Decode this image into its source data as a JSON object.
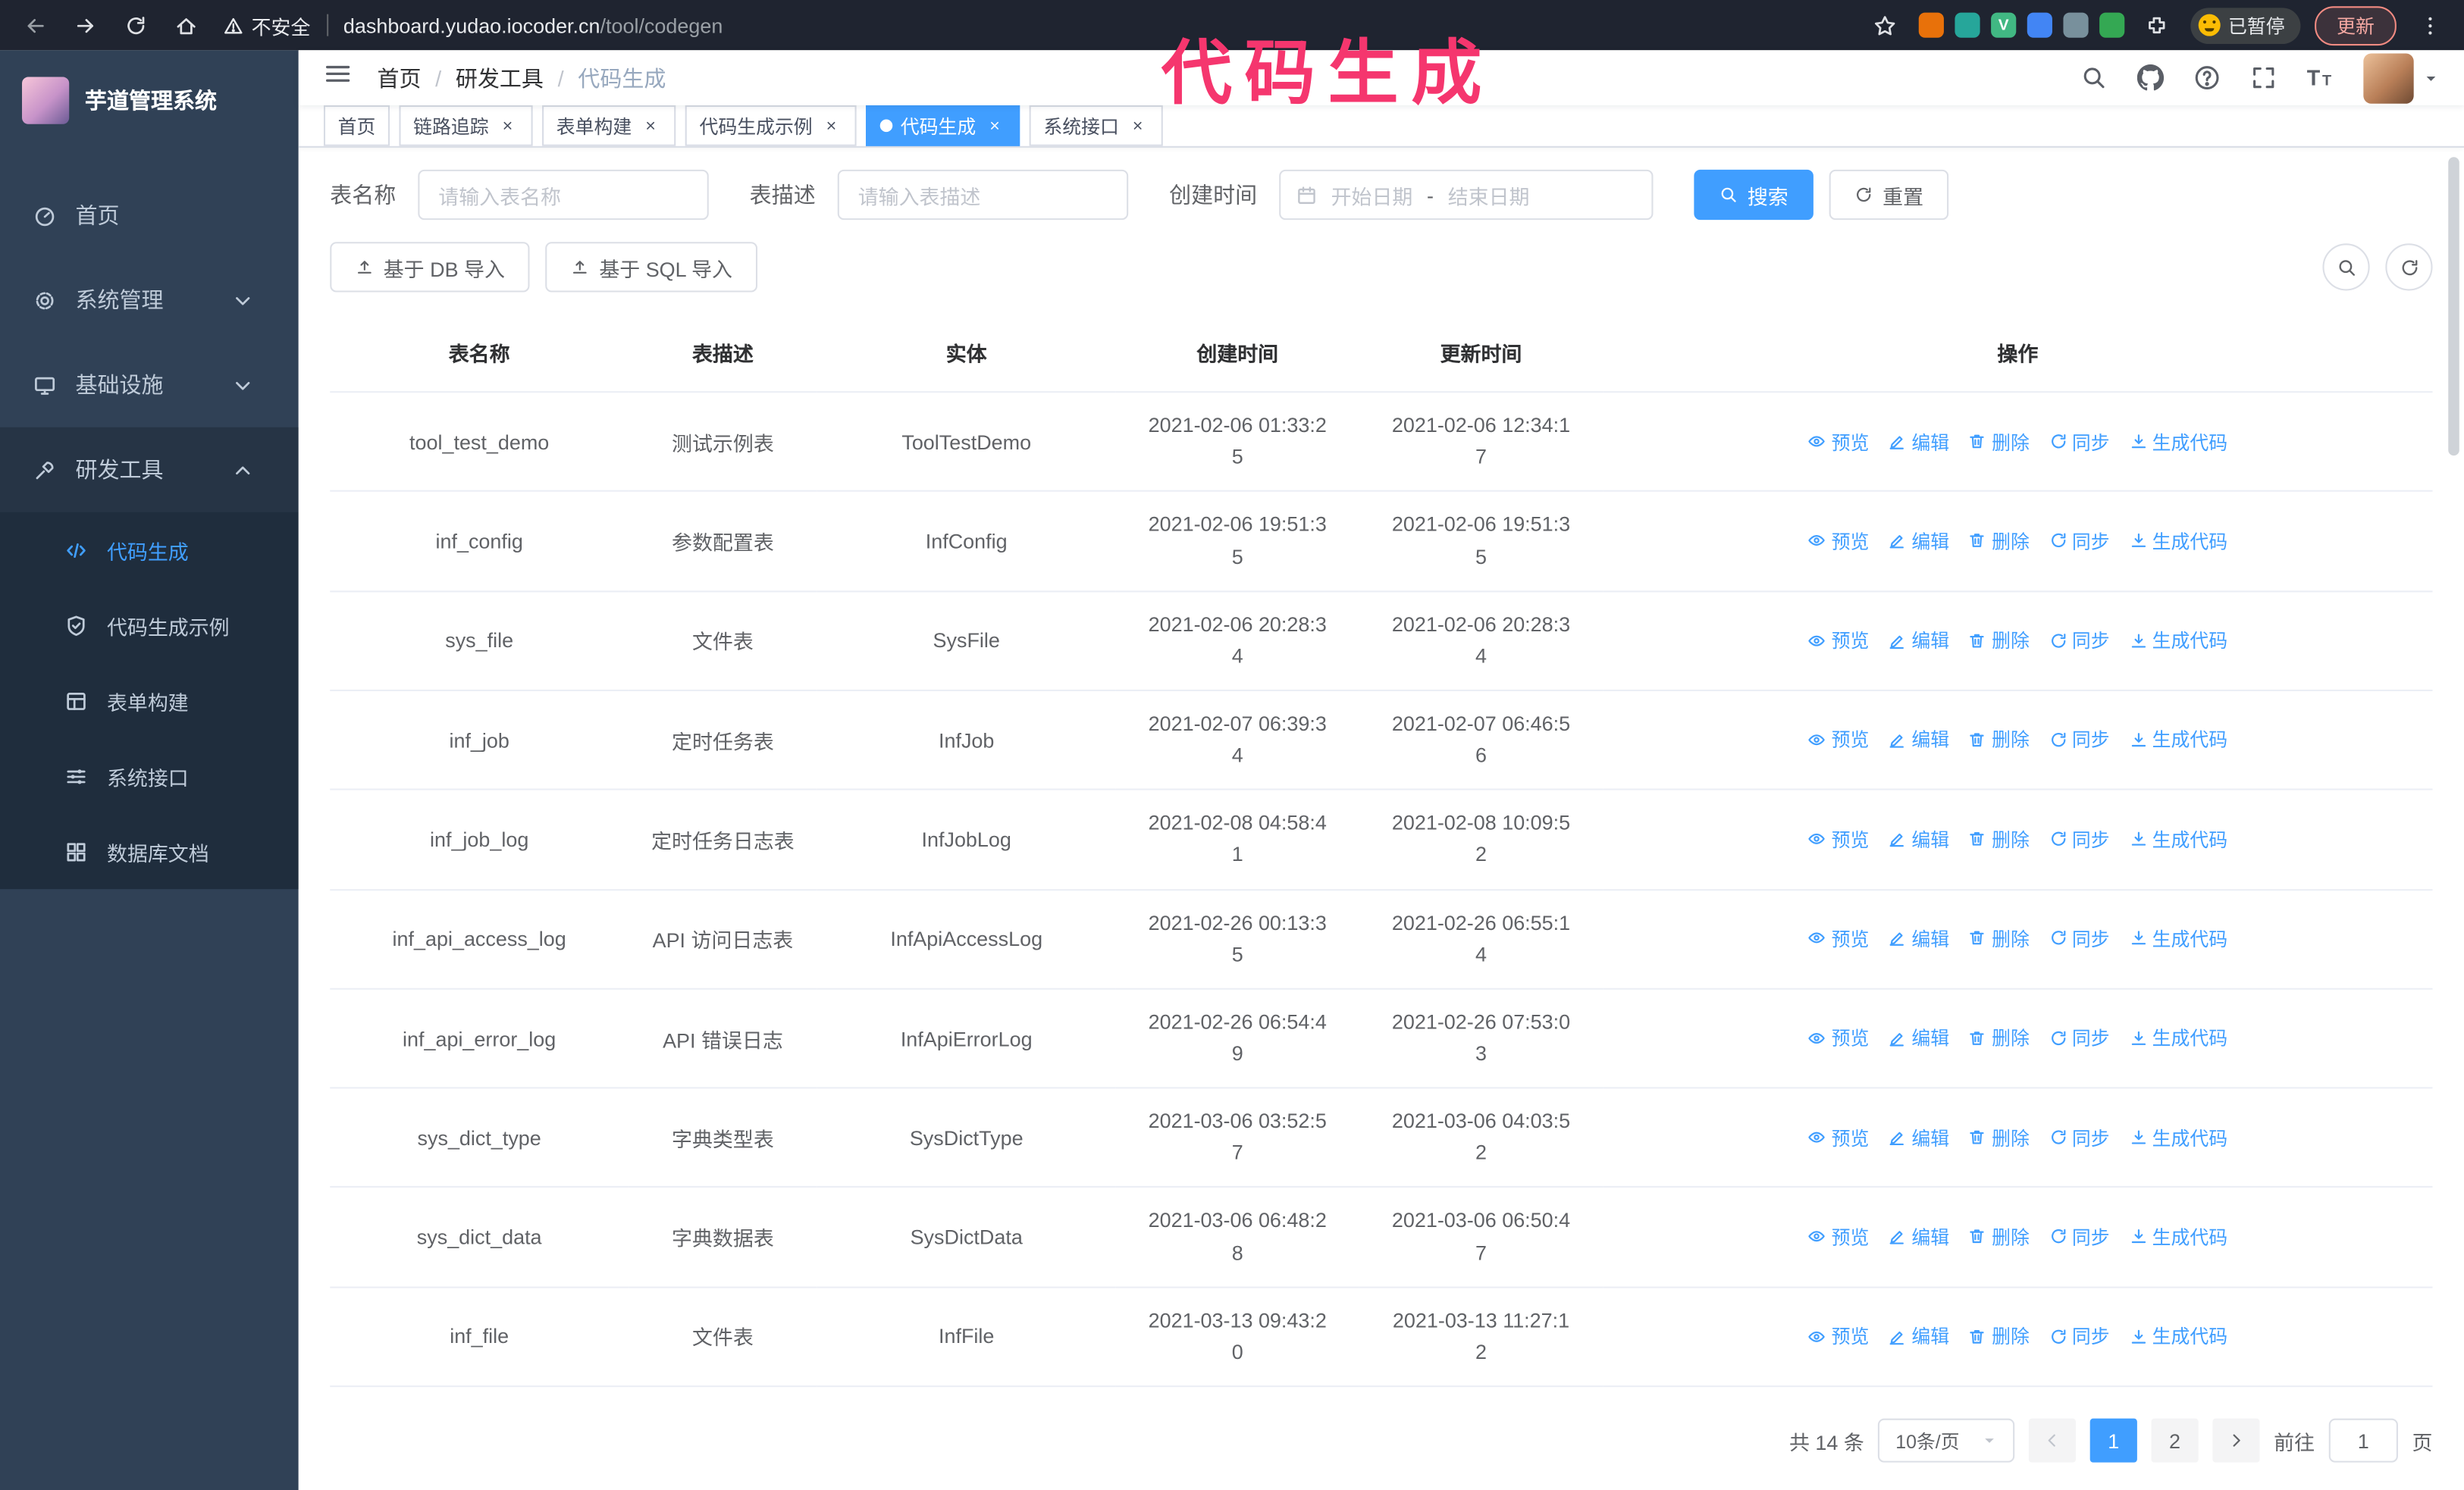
{
  "browser": {
    "security_label": "不安全",
    "url_host": "dashboard.yudao.iocoder.cn",
    "url_path": "/tool/codegen",
    "paused_badge": "已暂停",
    "update_button": "更新",
    "extensions": [
      {
        "name": "extension-icon",
        "color": "#e8710a",
        "glyph": ""
      },
      {
        "name": "extension-icon",
        "color": "#26a69a",
        "glyph": ""
      },
      {
        "name": "extension-icon",
        "color": "#41b883",
        "glyph": "V"
      },
      {
        "name": "extension-icon",
        "color": "#4285f4",
        "glyph": ""
      },
      {
        "name": "extension-icon",
        "color": "#78909c",
        "glyph": ""
      },
      {
        "name": "extension-icon",
        "color": "#34a853",
        "glyph": ""
      }
    ]
  },
  "annotation": {
    "text": "代码生成",
    "color": "#f5366e"
  },
  "sidebar": {
    "logo_title": "芋道管理系统",
    "items": [
      {
        "icon": "dashboard-icon",
        "label": "首页"
      },
      {
        "icon": "gear-icon",
        "label": "系统管理",
        "chevron": "down"
      },
      {
        "icon": "infra-icon",
        "label": "基础设施",
        "chevron": "down"
      },
      {
        "icon": "tools-icon",
        "label": "研发工具",
        "chevron": "up",
        "expanded": true,
        "children": [
          {
            "icon": "code-icon",
            "label": "代码生成",
            "active": true
          },
          {
            "icon": "example-icon",
            "label": "代码生成示例"
          },
          {
            "icon": "form-icon",
            "label": "表单构建"
          },
          {
            "icon": "api-icon",
            "label": "系统接口"
          },
          {
            "icon": "db-doc-icon",
            "label": "数据库文档"
          }
        ]
      }
    ]
  },
  "navbar": {
    "breadcrumb": [
      "首页",
      "研发工具",
      "代码生成"
    ],
    "separator": "/"
  },
  "tags": [
    {
      "label": "首页",
      "closable": false
    },
    {
      "label": "链路追踪",
      "closable": true
    },
    {
      "label": "表单构建",
      "closable": true
    },
    {
      "label": "代码生成示例",
      "closable": true
    },
    {
      "label": "代码生成",
      "closable": true,
      "active": true
    },
    {
      "label": "系统接口",
      "closable": true
    }
  ],
  "filters": {
    "table_name_label": "表名称",
    "table_name_placeholder": "请输入表名称",
    "table_desc_label": "表描述",
    "table_desc_placeholder": "请输入表描述",
    "create_time_label": "创建时间",
    "date_start_placeholder": "开始日期",
    "date_separator": "-",
    "date_end_placeholder": "结束日期",
    "search_button": "搜索",
    "reset_button": "重置"
  },
  "toolbar": {
    "import_db_button": "基于 DB 导入",
    "import_sql_button": "基于 SQL 导入"
  },
  "table": {
    "columns": [
      "表名称",
      "表描述",
      "实体",
      "创建时间",
      "更新时间",
      "操作"
    ],
    "actions": [
      {
        "name": "preview",
        "icon": "eye-icon",
        "label": "预览"
      },
      {
        "name": "edit",
        "icon": "edit-icon",
        "label": "编辑"
      },
      {
        "name": "delete",
        "icon": "delete-icon",
        "label": "删除"
      },
      {
        "name": "sync",
        "icon": "sync-icon",
        "label": "同步"
      },
      {
        "name": "generate-code",
        "icon": "download-icon",
        "label": "生成代码"
      }
    ],
    "rows": [
      {
        "name": "tool_test_demo",
        "desc": "测试示例表",
        "entity": "ToolTestDemo",
        "created": "2021-02-06 01:33:25",
        "updated": "2021-02-06 12:34:17"
      },
      {
        "name": "inf_config",
        "desc": "参数配置表",
        "entity": "InfConfig",
        "created": "2021-02-06 19:51:35",
        "updated": "2021-02-06 19:51:35"
      },
      {
        "name": "sys_file",
        "desc": "文件表",
        "entity": "SysFile",
        "created": "2021-02-06 20:28:34",
        "updated": "2021-02-06 20:28:34"
      },
      {
        "name": "inf_job",
        "desc": "定时任务表",
        "entity": "InfJob",
        "created": "2021-02-07 06:39:34",
        "updated": "2021-02-07 06:46:56"
      },
      {
        "name": "inf_job_log",
        "desc": "定时任务日志表",
        "entity": "InfJobLog",
        "created": "2021-02-08 04:58:41",
        "updated": "2021-02-08 10:09:52"
      },
      {
        "name": "inf_api_access_log",
        "desc": "API 访问日志表",
        "entity": "InfApiAccessLog",
        "created": "2021-02-26 00:13:35",
        "updated": "2021-02-26 06:55:14"
      },
      {
        "name": "inf_api_error_log",
        "desc": "API 错误日志",
        "entity": "InfApiErrorLog",
        "created": "2021-02-26 06:54:49",
        "updated": "2021-02-26 07:53:03"
      },
      {
        "name": "sys_dict_type",
        "desc": "字典类型表",
        "entity": "SysDictType",
        "created": "2021-03-06 03:52:57",
        "updated": "2021-03-06 04:03:52"
      },
      {
        "name": "sys_dict_data",
        "desc": "字典数据表",
        "entity": "SysDictData",
        "created": "2021-03-06 06:48:28",
        "updated": "2021-03-06 06:50:47"
      },
      {
        "name": "inf_file",
        "desc": "文件表",
        "entity": "InfFile",
        "created": "2021-03-13 09:43:20",
        "updated": "2021-03-13 11:27:12"
      }
    ]
  },
  "pagination": {
    "total_text": "共 14 条",
    "page_size": "10条/页",
    "pages": [
      "1",
      "2"
    ],
    "active_page": "1",
    "goto_label": "前往",
    "goto_value": "1",
    "goto_suffix": "页"
  },
  "colors": {
    "accent": "#409eff",
    "sidebar_bg": "#304156",
    "submenu_bg": "#1f2d3d",
    "chrome_bg": "#1f2430",
    "annotation": "#f5366e"
  }
}
